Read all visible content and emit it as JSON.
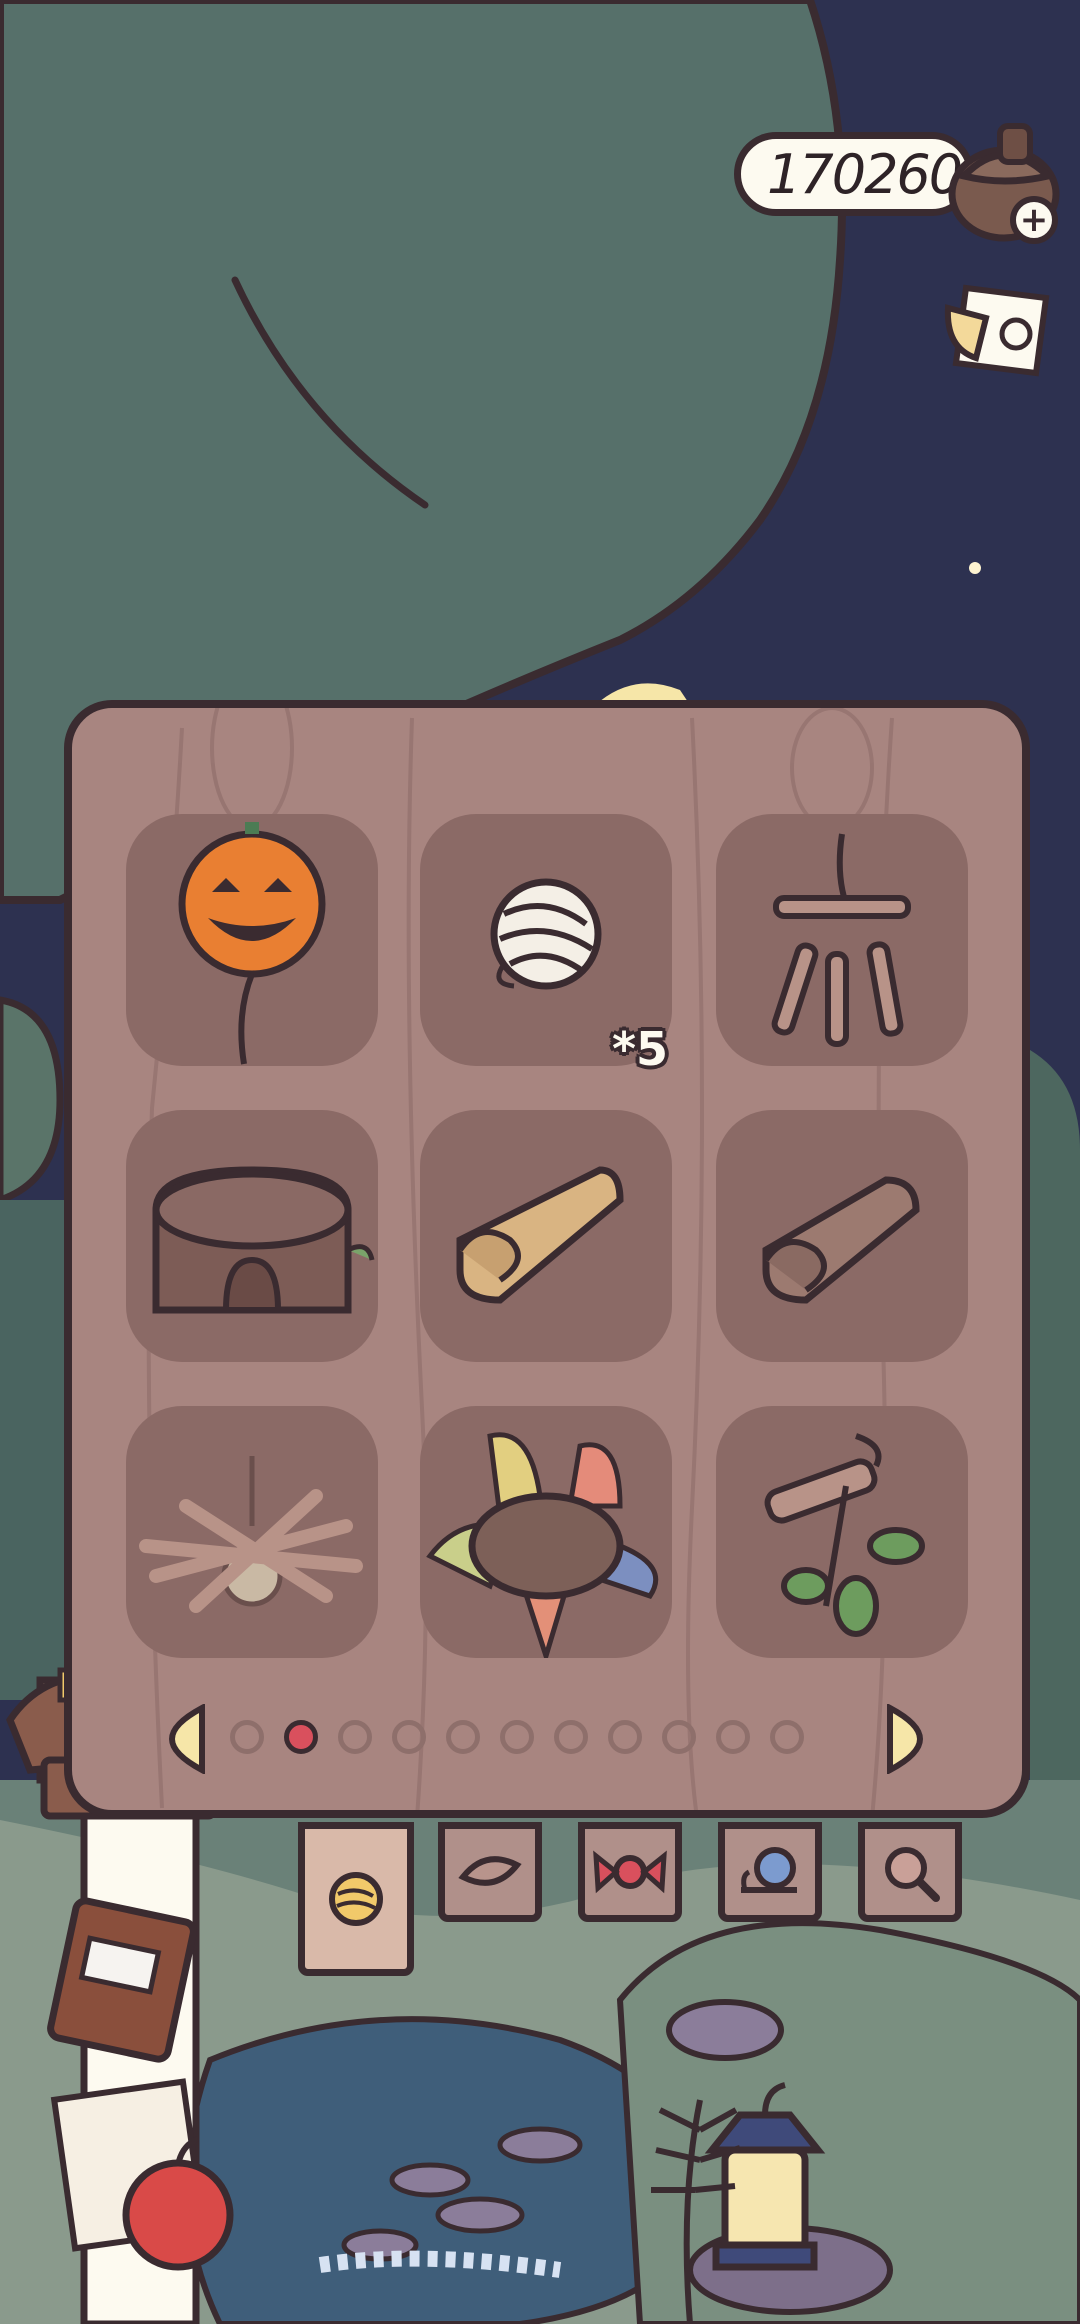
{
  "hud": {
    "acorn_count": "170260",
    "acorn_icon": "acorn-icon",
    "add_icon": "plus-icon",
    "mail_icon": "letter-icon"
  },
  "inventory": {
    "page_count": 11,
    "active_page": 1,
    "items": [
      {
        "icon": "pumpkin-balloon-icon",
        "count": ""
      },
      {
        "icon": "yarn-ball-icon",
        "count": "*5"
      },
      {
        "icon": "stick-wind-chime-icon",
        "count": ""
      },
      {
        "icon": "tree-stump-house-icon",
        "count": ""
      },
      {
        "icon": "fabric-roll-icon",
        "count": ""
      },
      {
        "icon": "leather-roll-icon",
        "count": ""
      },
      {
        "icon": "stick-campfire-icon",
        "count": ""
      },
      {
        "icon": "patchwork-cushion-icon",
        "count": ""
      },
      {
        "icon": "leafy-twig-icon",
        "count": ""
      }
    ]
  },
  "tabs": [
    {
      "icon": "yarn-tab-icon",
      "active": true
    },
    {
      "icon": "leaf-tab-icon",
      "active": false
    },
    {
      "icon": "candy-tab-icon",
      "active": false
    },
    {
      "icon": "snail-tab-icon",
      "active": false
    },
    {
      "icon": "magnifier-tab-icon",
      "active": false
    }
  ],
  "colors": {
    "accent_red": "#d9505d",
    "panel_wood": "#a88580",
    "outline": "#3a2b30",
    "sky": "#2d3150",
    "tree": "#56706a"
  }
}
